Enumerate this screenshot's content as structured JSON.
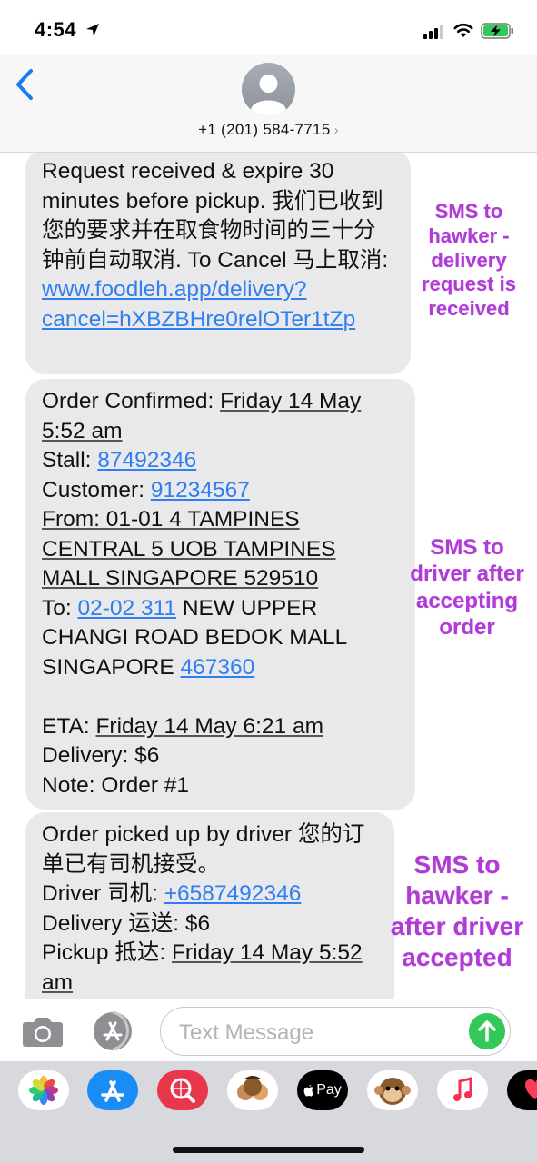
{
  "status_bar": {
    "time": "4:54"
  },
  "header": {
    "contact": "+1 (201) 584-7715",
    "chevron": "›"
  },
  "messages": [
    {
      "text1": "Request received & expire 30 minutes before pickup.  我们已收到您的要求并在取食物时间的三十分钟前自动取消. To Cancel 马上取消: ",
      "link": "www.foodleh.app/delivery?cancel=hXBZBHre0relOTer1tZp"
    },
    {
      "label_confirmed": "Order Confirmed: ",
      "date_confirmed": "Friday 14 May 5:52 am",
      "label_stall": " Stall: ",
      "stall_phone": "87492346",
      "label_customer": "Customer: ",
      "customer_phone": "91234567",
      "from_address": "From: 01-01 4 TAMPINES CENTRAL 5 UOB TAMPINES MALL SINGAPORE 529510",
      "label_to": "To: ",
      "to_unit": "02-02 311",
      "to_address": " NEW UPPER CHANGI ROAD BEDOK MALL SINGAPORE ",
      "to_postal": "467360",
      "label_eta": "ETA: ",
      "eta_date": "Friday 14 May 6:21 am",
      "delivery": "Delivery: $6",
      "note": "Note: Order #1"
    },
    {
      "text1": "Order picked up by driver 您的订单已有司机接受。",
      "label_driver": " Driver 司机: ",
      "driver_phone": "+6587492346",
      "delivery": " Delivery 运送: $6",
      "label_pickup": " Pickup 抵达: ",
      "pickup_date": "Friday 14 May 5:52 am"
    }
  ],
  "annotations": [
    "SMS to hawker - delivery request is received",
    "SMS to driver after accepting order",
    "SMS to hawker - after driver accepted"
  ],
  "input": {
    "placeholder": "Text Message"
  },
  "drawer": {
    "apple_pay": "Pay"
  },
  "colors": {
    "link": "#2f7ff1",
    "bubble": "#e9e9eb",
    "annotation": "#b03bd6",
    "send": "#34c759"
  }
}
